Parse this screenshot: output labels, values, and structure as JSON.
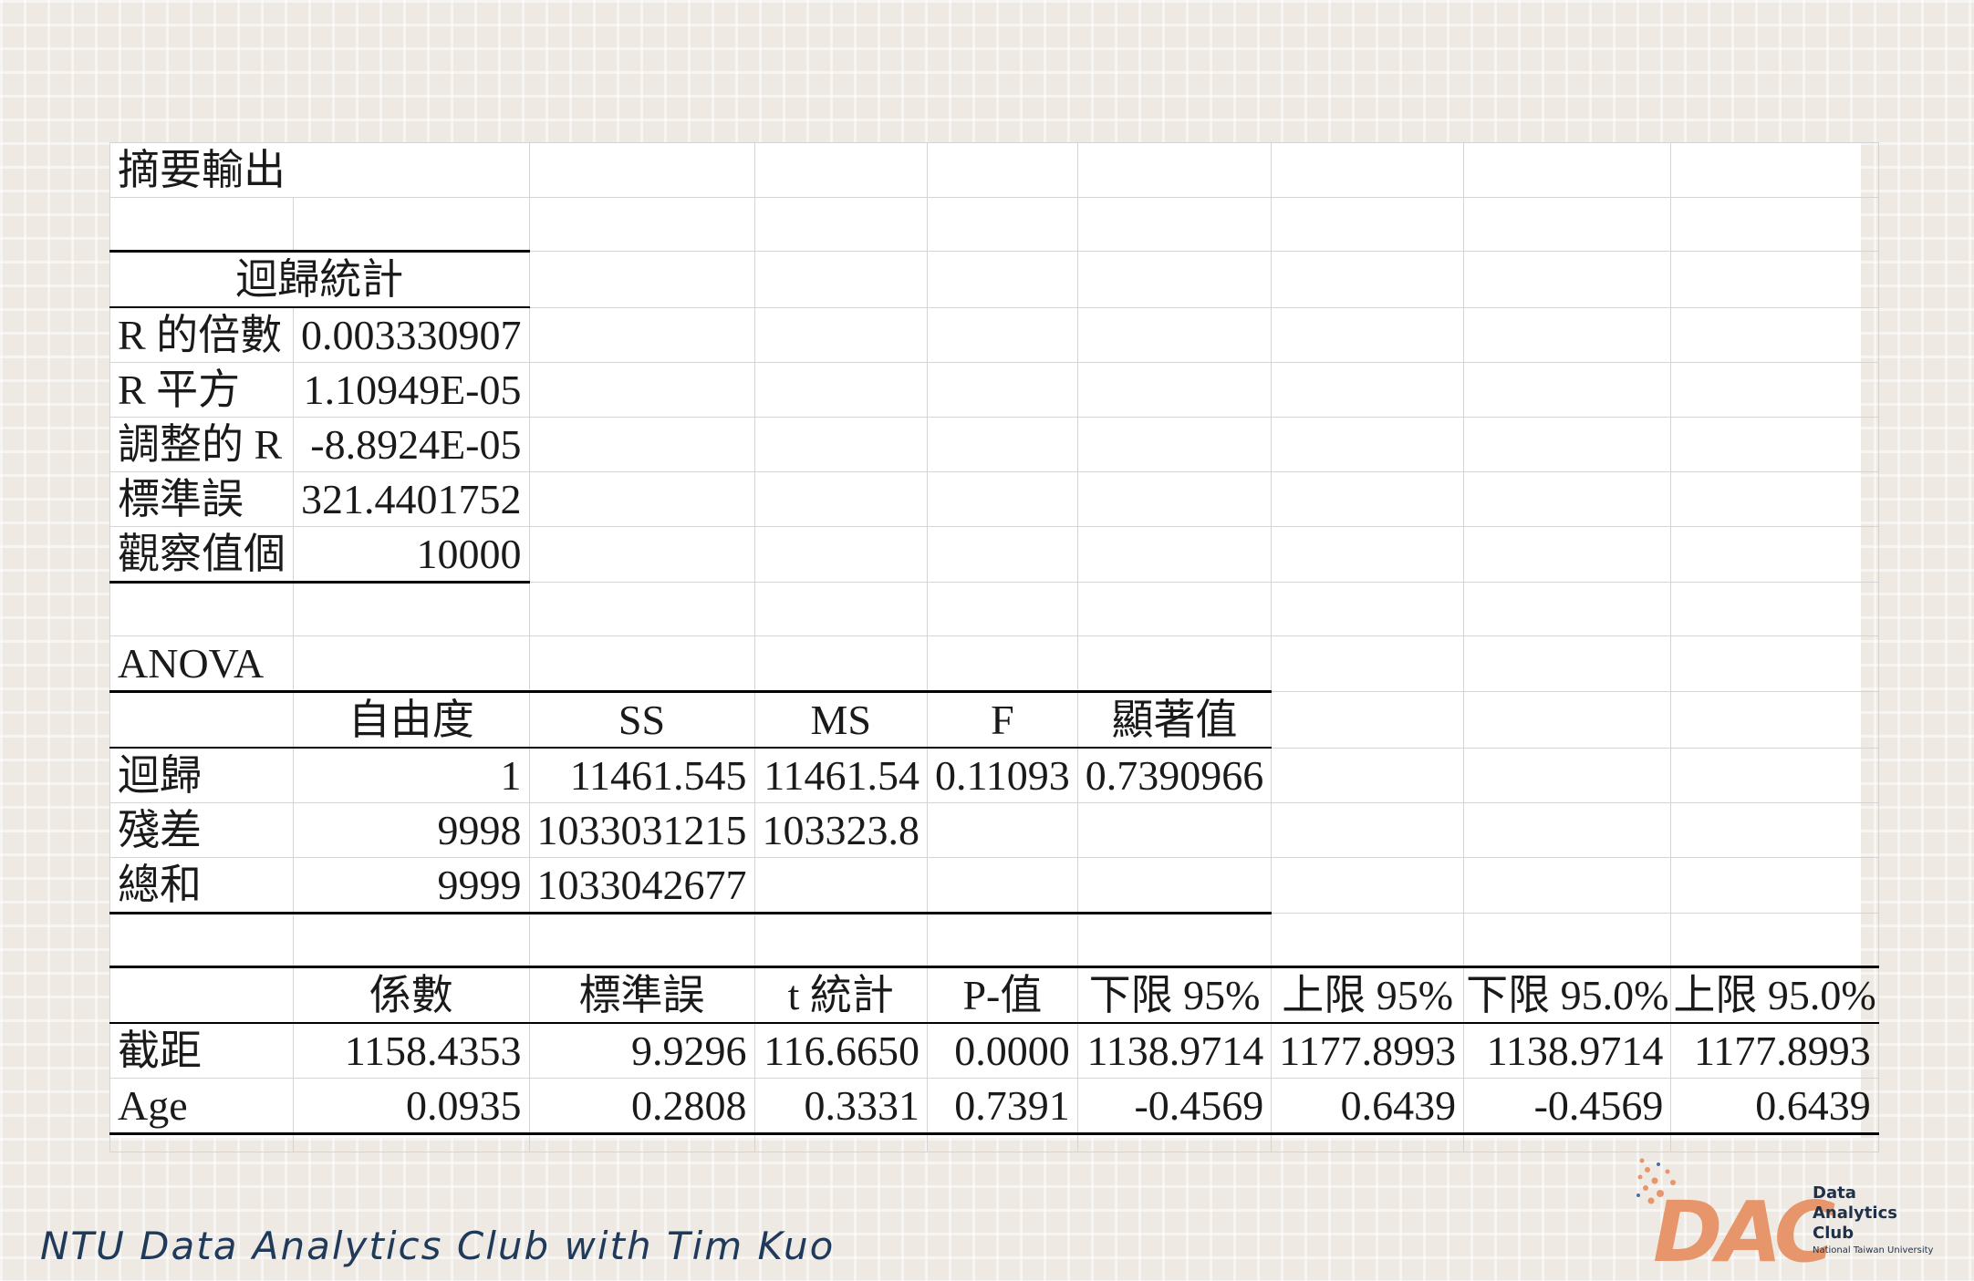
{
  "title": "摘要輸出",
  "regression_stats": {
    "header": "迴歸統計",
    "rows": [
      {
        "label": "R 的倍數",
        "value": "0.003330907"
      },
      {
        "label": "R 平方",
        "value": "1.10949E-05"
      },
      {
        "label": "調整的 R",
        "value": "-8.8924E-05"
      },
      {
        "label": "標準誤",
        "value": "321.4401752"
      },
      {
        "label": "觀察值個",
        "value": "10000"
      }
    ]
  },
  "anova": {
    "label": "ANOVA",
    "headers": [
      "",
      "自由度",
      "SS",
      "MS",
      "F",
      "顯著值"
    ],
    "rows": [
      {
        "label": "迴歸",
        "df": "1",
        "ss": "11461.545",
        "ms": "11461.54",
        "f": "0.11093",
        "sig": "0.7390966"
      },
      {
        "label": "殘差",
        "df": "9998",
        "ss": "1033031215",
        "ms": "103323.8",
        "f": "",
        "sig": ""
      },
      {
        "label": "總和",
        "df": "9999",
        "ss": "1033042677",
        "ms": "",
        "f": "",
        "sig": ""
      }
    ]
  },
  "coefficients": {
    "headers": [
      "",
      "係數",
      "標準誤",
      "t 統計",
      "P-值",
      "下限 95%",
      "上限 95%",
      "下限 95.0%",
      "上限 95.0%"
    ],
    "rows": [
      {
        "label": "截距",
        "values": [
          "1158.4353",
          "9.9296",
          "116.6650",
          "0.0000",
          "1138.9714",
          "1177.8993",
          "1138.9714",
          "1177.8993"
        ]
      },
      {
        "label": "Age",
        "values": [
          "0.0935",
          "0.2808",
          "0.3331",
          "0.7391",
          "-0.4569",
          "0.6439",
          "-0.4569",
          "0.6439"
        ]
      }
    ]
  },
  "footer": {
    "text": "NTU Data Analytics Club with Tim Kuo",
    "logo_mark": "DAC",
    "logo_lines": [
      "Data",
      "Analytics",
      "Club"
    ],
    "logo_subtitle": "National Taiwan University"
  },
  "colors": {
    "footer_text": "#1f3a5a",
    "logo_orange": "#e7956a",
    "logo_navy": "#1f3148"
  }
}
